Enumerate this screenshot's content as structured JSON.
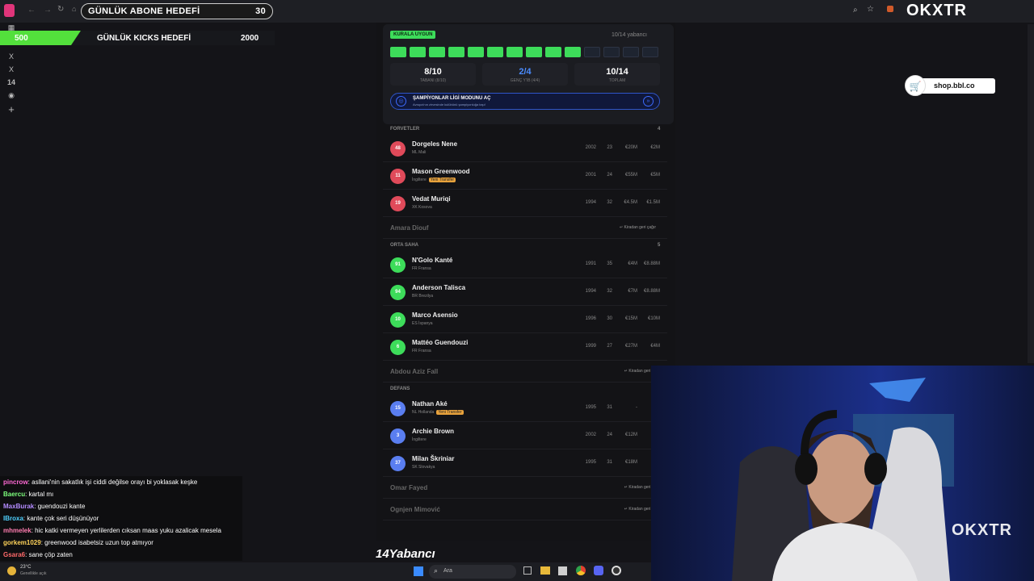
{
  "browser": {
    "sub_goal_label": "GÜNLÜK ABONE HEDEFİ",
    "sub_goal_count": "30",
    "search_icon": "search-icon",
    "star_icon": "star-icon"
  },
  "kicks": {
    "current": "500",
    "label": "GÜNLÜK KICKS HEDEFİ",
    "target": "2000",
    "progress": 0.25
  },
  "brand": {
    "logo_text": "OKXTR"
  },
  "side_icons": [
    "X",
    "X",
    "14",
    "◉"
  ],
  "card": {
    "badge": "KURALA UYGUN",
    "counter": "10/14 yabancı",
    "segments_filled": 10,
    "segments_total": 14,
    "stats": [
      {
        "value": "8/10",
        "label": "TABANI (8/10)"
      },
      {
        "value": "2/4",
        "label": "GENÇ Y'IB (4/4)"
      },
      {
        "value": "10/14",
        "label": "TOPLAM"
      }
    ],
    "cl_title": "ŞAMPİYONLAR LİGİ MODUNU AÇ",
    "cl_sub": "Avrupa'nın zirvesinde kulübünü şampiyonluğa taşı!"
  },
  "sections": {
    "forvetler": "FORVETLER",
    "forvetler_count": "4",
    "orta": "ORTA SAHA",
    "orta_count": "5",
    "defans": "DEFANS"
  },
  "forwards": [
    {
      "num": "48",
      "name": "Dorgeles Nene",
      "country": "ML Mali",
      "tag": "",
      "year": "2002",
      "age": "23",
      "value": "€20M",
      "wage": "€2M"
    },
    {
      "num": "11",
      "name": "Mason Greenwood",
      "country": "İngiltere",
      "tag": "Yeni Transfer",
      "year": "2001",
      "age": "24",
      "value": "€55M",
      "wage": "€5M"
    },
    {
      "num": "19",
      "name": "Vedat Muriqi",
      "country": "XK Kosova",
      "tag": "",
      "year": "1994",
      "age": "32",
      "value": "€4.5M",
      "wage": "€1.5M"
    }
  ],
  "forward_loan": {
    "name": "Amara Diouf",
    "btn": "↵ Kiradan geri çağır"
  },
  "mids": [
    {
      "num": "91",
      "name": "N'Golo Kanté",
      "country": "FR Fransa",
      "tag": "",
      "year": "1991",
      "age": "35",
      "value": "€4M",
      "wage": "€8.88M"
    },
    {
      "num": "94",
      "name": "Anderson Talisca",
      "country": "BR Brezilya",
      "tag": "",
      "year": "1994",
      "age": "32",
      "value": "€7M",
      "wage": "€8.88M"
    },
    {
      "num": "10",
      "name": "Marco Asensio",
      "country": "ES İspanya",
      "tag": "",
      "year": "1996",
      "age": "30",
      "value": "€15M",
      "wage": "€10M"
    },
    {
      "num": "6",
      "name": "Mattéo Guendouzi",
      "country": "FR Fransa",
      "tag": "",
      "year": "1999",
      "age": "27",
      "value": "€27M",
      "wage": "€4M"
    }
  ],
  "mid_loan": {
    "name": "Abdou Aziz Fall",
    "btn": "↵ Kiradan geri ça"
  },
  "defs": [
    {
      "num": "15",
      "name": "Nathan Aké",
      "country": "NL Hollanda",
      "tag": "Yeni Transfer",
      "year": "1995",
      "age": "31",
      "value": "-",
      "wage": ""
    },
    {
      "num": "3",
      "name": "Archie Brown",
      "country": "İngiltere",
      "tag": "",
      "year": "2002",
      "age": "24",
      "value": "€12M",
      "wage": ""
    },
    {
      "num": "37",
      "name": "Milan Škriniar",
      "country": "SK Slovakya",
      "tag": "",
      "year": "1995",
      "age": "31",
      "value": "€18M",
      "wage": ""
    }
  ],
  "def_loans": [
    {
      "name": "Omar Fayed",
      "btn": "↵ Kiradan geri ça"
    },
    {
      "name": "Ognjen Mimović",
      "btn": "↵ Kiradan geri ça"
    }
  ],
  "footer_title": "14Yabancı",
  "shop": {
    "text": "shop.bbl.co"
  },
  "chat": [
    {
      "user": "pincrow",
      "color": "#ff6ad5",
      "msg": ": asllani'nin sakatlık işi ciddi değilse orayı bi yoklasak keşke"
    },
    {
      "user": "Baercu",
      "color": "#7dff7d",
      "msg": ": kartal mı"
    },
    {
      "user": "MaxBurak",
      "color": "#b48cff",
      "msg": ": guendouzi  kante"
    },
    {
      "user": "IBroxa",
      "color": "#4fd1ff",
      "msg": ": kante çok seri düşünüyor"
    },
    {
      "user": "mhmelek",
      "color": "#ff7db0",
      "msg": ": hic katki vermeyen yerlilerden cıksan maas yuku azalicak mesela"
    },
    {
      "user": "gorkem1029",
      "color": "#ffd35a",
      "msg": ": greenwood isabetsiz uzun top atmıyor"
    },
    {
      "user": "Gsara6",
      "color": "#ff6a6a",
      "msg": ": sane çöp zaten"
    }
  ],
  "taskbar": {
    "weather_temp": "23°C",
    "weather_desc": "Genellikle açık",
    "search": "Ara"
  },
  "colors": {
    "green": "#3ddc5a",
    "red": "#e04a5a",
    "blue": "#5a7ef0",
    "accent_blue": "#3d6bff",
    "kicks_green": "#53e03c"
  }
}
